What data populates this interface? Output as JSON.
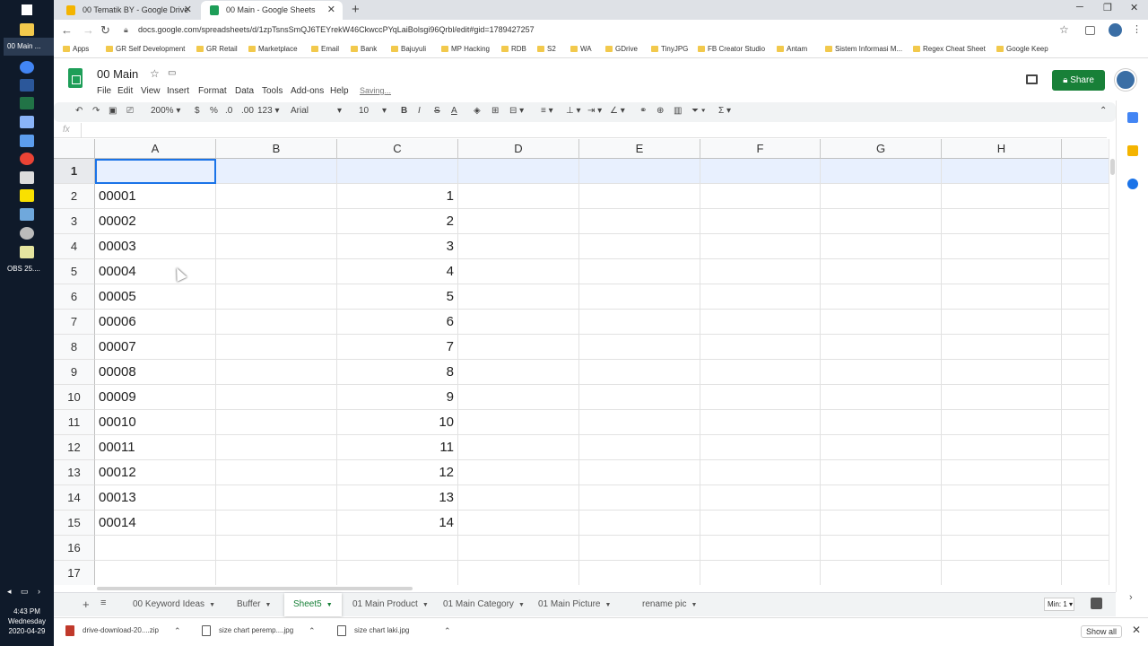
{
  "taskbar": {
    "window_label": "00 Main ...",
    "obs_label": "OBS 25....",
    "time": "4:43 PM",
    "day": "Wednesday",
    "date": "2020-04-29"
  },
  "browser": {
    "tabs": [
      {
        "title": "00 Tematik BY - Google Drive",
        "icon": "google-drive-icon",
        "color": "#f4b400"
      },
      {
        "title": "00 Main - Google Sheets",
        "icon": "google-sheets-icon",
        "color": "#1e9e58"
      }
    ],
    "url": "docs.google.com/spreadsheets/d/1zpTsnsSmQJ6TEYrekW46CkwccPYqLaiBolsgi96Qrbl/edit#gid=1789427257",
    "bookmarks": [
      "Apps",
      "GR Self Development",
      "GR Retail",
      "Marketplace",
      "Email",
      "Bank",
      "Bajuyuli",
      "MP Hacking",
      "RDB",
      "S2",
      "WA",
      "GDrive",
      "TinyJPG",
      "FB Creator Studio",
      "Antam",
      "Sistem Informasi M...",
      "Regex Cheat Sheet",
      "Google Keep"
    ]
  },
  "doc": {
    "title": "00 Main",
    "menu": [
      "File",
      "Edit",
      "View",
      "Insert",
      "Format",
      "Data",
      "Tools",
      "Add-ons",
      "Help"
    ],
    "saving": "Saving...",
    "share_label": "Share"
  },
  "toolbar": {
    "zoom": "200%",
    "currency": "$",
    "percent": "%",
    "dec_less": ".0",
    "dec_more": ".00",
    "format_more": "123",
    "font": "Arial",
    "font_size": "10",
    "bold": "B",
    "italic": "I",
    "strike": "S",
    "text_color": "A",
    "sigma": "Σ"
  },
  "formula": {
    "fx": "fx",
    "value": ""
  },
  "grid": {
    "columns": [
      "A",
      "B",
      "C",
      "D",
      "E",
      "F",
      "G",
      "H"
    ],
    "rows": [
      {
        "n": "1",
        "a": "",
        "c": ""
      },
      {
        "n": "2",
        "a": "00001",
        "c": "1"
      },
      {
        "n": "3",
        "a": "00002",
        "c": "2"
      },
      {
        "n": "4",
        "a": "00003",
        "c": "3"
      },
      {
        "n": "5",
        "a": "00004",
        "c": "4"
      },
      {
        "n": "6",
        "a": "00005",
        "c": "5"
      },
      {
        "n": "7",
        "a": "00006",
        "c": "6"
      },
      {
        "n": "8",
        "a": "00007",
        "c": "7"
      },
      {
        "n": "9",
        "a": "00008",
        "c": "8"
      },
      {
        "n": "10",
        "a": "00009",
        "c": "9"
      },
      {
        "n": "11",
        "a": "00010",
        "c": "10"
      },
      {
        "n": "12",
        "a": "00011",
        "c": "11"
      },
      {
        "n": "13",
        "a": "00012",
        "c": "12"
      },
      {
        "n": "14",
        "a": "00013",
        "c": "13"
      },
      {
        "n": "15",
        "a": "00014",
        "c": "14"
      },
      {
        "n": "16",
        "a": "",
        "c": ""
      },
      {
        "n": "17",
        "a": "",
        "c": ""
      }
    ]
  },
  "sheets": {
    "tabs": [
      "00 Keyword Ideas",
      "Buffer",
      "Sheet5",
      "01 Main Product",
      "01 Main Category",
      "01 Main Picture",
      "rename pic"
    ],
    "active": "Sheet5",
    "min_label": "Min: 1"
  },
  "downloads": {
    "items": [
      "drive-download-20....zip",
      "size chart peremp....jpg",
      "size chart laki.jpg"
    ],
    "show_all": "Show all"
  }
}
